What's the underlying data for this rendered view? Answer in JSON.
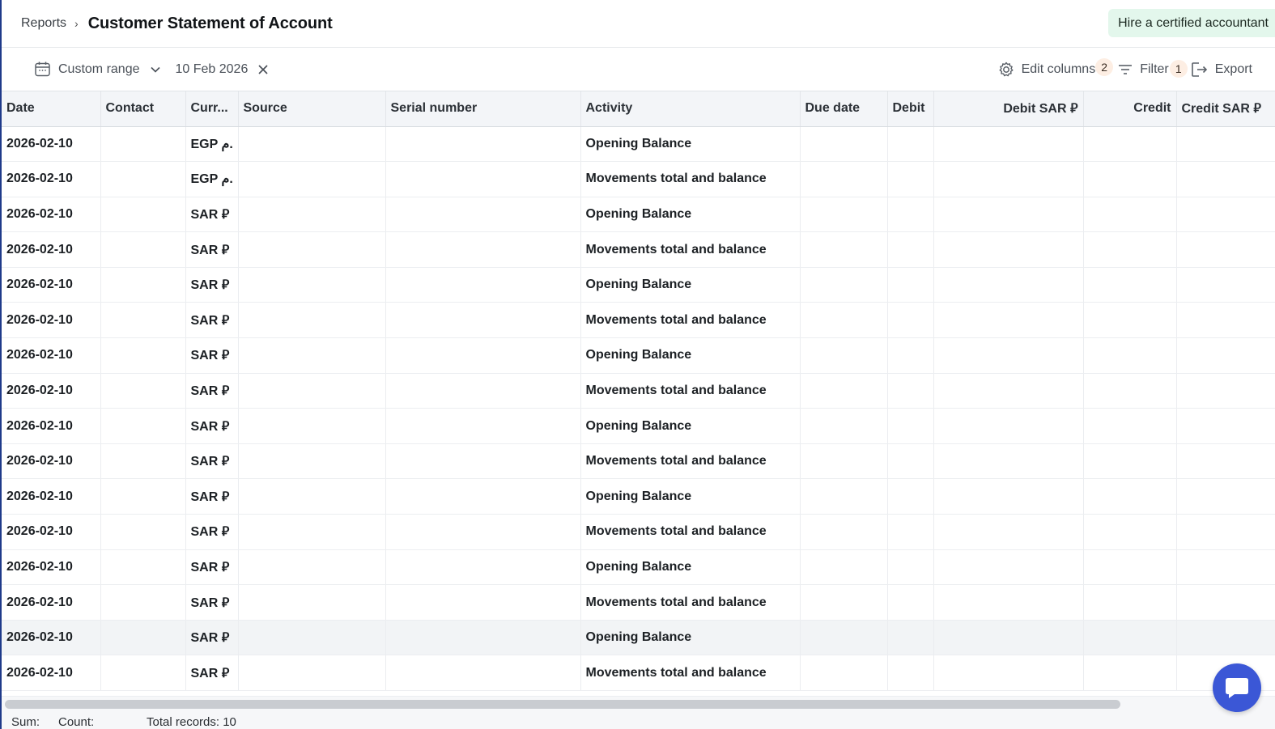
{
  "breadcrumb": {
    "parent": "Reports",
    "separator": "›"
  },
  "page": {
    "title": "Customer Statement of Account"
  },
  "actions": {
    "hire_label": "Hire a certified accountant"
  },
  "toolbar": {
    "range_label": "Custom range",
    "date_value": "10 Feb 2026",
    "edit_columns_label": "Edit columns",
    "edit_columns_badge": "2",
    "filter_label": "Filter",
    "filter_badge": "1",
    "export_label": "Export"
  },
  "table": {
    "columns": [
      "Date",
      "Contact",
      "Curr...",
      "Source",
      "Serial number",
      "Activity",
      "Due date",
      "Debit",
      "Debit SAR ⃁",
      "Credit",
      "Credit SAR ⃁"
    ],
    "rows": [
      {
        "date": "2026-02-10",
        "contact": "",
        "currency": "EGP م.",
        "source": "",
        "serial": "",
        "activity": "Opening Balance"
      },
      {
        "date": "2026-02-10",
        "contact": "",
        "currency": "EGP م.",
        "source": "",
        "serial": "",
        "activity": "Movements total and balance"
      },
      {
        "date": "2026-02-10",
        "contact": "",
        "currency": "SAR ⃁",
        "source": "",
        "serial": "",
        "activity": "Opening Balance"
      },
      {
        "date": "2026-02-10",
        "contact": "",
        "currency": "SAR ⃁",
        "source": "",
        "serial": "",
        "activity": "Movements total and balance"
      },
      {
        "date": "2026-02-10",
        "contact": "",
        "currency": "SAR ⃁",
        "source": "",
        "serial": "",
        "activity": "Opening Balance"
      },
      {
        "date": "2026-02-10",
        "contact": "",
        "currency": "SAR ⃁",
        "source": "",
        "serial": "",
        "activity": "Movements total and balance"
      },
      {
        "date": "2026-02-10",
        "contact": "",
        "currency": "SAR ⃁",
        "source": "",
        "serial": "",
        "activity": "Opening Balance"
      },
      {
        "date": "2026-02-10",
        "contact": "",
        "currency": "SAR ⃁",
        "source": "",
        "serial": "",
        "activity": "Movements total and balance"
      },
      {
        "date": "2026-02-10",
        "contact": "",
        "currency": "SAR ⃁",
        "source": "",
        "serial": "",
        "activity": "Opening Balance"
      },
      {
        "date": "2026-02-10",
        "contact": "",
        "currency": "SAR ⃁",
        "source": "",
        "serial": "",
        "activity": "Movements total and balance"
      },
      {
        "date": "2026-02-10",
        "contact": "",
        "currency": "SAR ⃁",
        "source": "",
        "serial": "",
        "activity": "Opening Balance"
      },
      {
        "date": "2026-02-10",
        "contact": "",
        "currency": "SAR ⃁",
        "source": "",
        "serial": "",
        "activity": "Movements total and balance"
      },
      {
        "date": "2026-02-10",
        "contact": "",
        "currency": "SAR ⃁",
        "source": "",
        "serial": "",
        "activity": "Opening Balance"
      },
      {
        "date": "2026-02-10",
        "contact": "",
        "currency": "SAR ⃁",
        "source": "",
        "serial": "",
        "activity": "Movements total and balance"
      },
      {
        "date": "2026-02-10",
        "contact": "",
        "currency": "SAR ⃁",
        "source": "",
        "serial": "",
        "activity": "Opening Balance"
      },
      {
        "date": "2026-02-10",
        "contact": "",
        "currency": "SAR ⃁",
        "source": "",
        "serial": "",
        "activity": "Movements total and balance"
      }
    ]
  },
  "footer": {
    "sum_label": "Sum:",
    "count_label": "Count:",
    "total_label": "Total records: 10"
  },
  "colors": {
    "accent": "#3b57d6",
    "hire_bg": "#e3f7ec",
    "badge_bg": "#fdeee3"
  },
  "icons": {
    "calendar": "calendar-icon",
    "chevron": "chevron-down-icon",
    "clear": "close-icon",
    "settings": "gear-icon",
    "filter": "filter-icon",
    "export": "export-icon",
    "chat": "chat-icon"
  }
}
